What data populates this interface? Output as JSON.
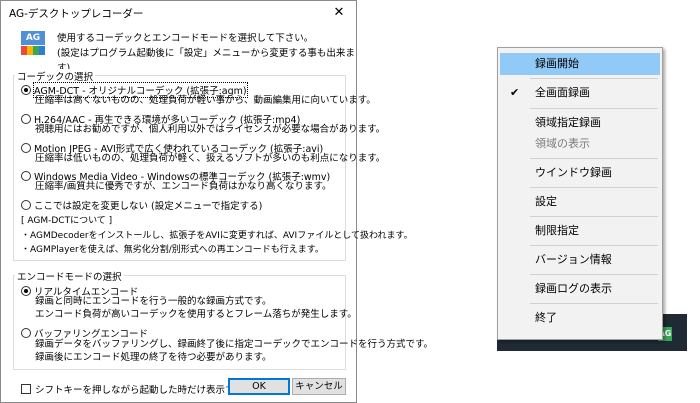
{
  "dialog": {
    "title": "AG-デスクトップレコーダー",
    "close_glyph": "✕",
    "intro_line1": "使用するコーデックとエンコードモードを選択して下さい。",
    "intro_line2": "(設定はプログラム起動後に「設定」メニューから変更する事も出来ます)",
    "icon_label": "AG",
    "icon_bar_colors": [
      "#e94b3c",
      "#f6b600",
      "#3aa757",
      "#2d7fd3"
    ],
    "codec_group": {
      "legend": "コーデックの選択",
      "options": [
        {
          "label": "AGM-DCT - オリジナルコーデック (拡張子:agm)",
          "desc": "圧縮率は高くないものの、処理負荷が軽い事から、動画編集用に向いています。",
          "checked": true
        },
        {
          "label": "H.264/AAC - 再生できる環境が多いコーデック (拡張子:mp4)",
          "desc": "視聴用にはお勧めですが、個人利用以外ではライセンスが必要な場合があります。",
          "checked": false
        },
        {
          "label": "Motion JPEG - AVI形式で広く使われているコーデック (拡張子:avi)",
          "desc": "圧縮率は低いものの、処理負荷が軽く、扱えるソフトが多いのも利点になります。",
          "checked": false
        },
        {
          "label": "Windows Media Video - Windowsの標準コーデック (拡張子:wmv)",
          "desc": "圧縮率/画質共に優秀ですが、エンコード負荷はかなり高くなります。",
          "checked": false
        },
        {
          "label": "ここでは設定を変更しない (設定メニューで指定する)",
          "desc": "",
          "checked": false
        }
      ],
      "note_title": "[ AGM-DCTについて ]",
      "note_line1": "・AGMDecoderをインストールし、拡張子をAVIに変更すれば、AVIファイルとして扱われます。",
      "note_line2": "・AGMPlayerを使えば、無劣化分割/別形式への再エンコードも行えます。"
    },
    "encode_group": {
      "legend": "エンコードモードの選択",
      "options": [
        {
          "label": "リアルタイムエンコード",
          "desc1": "録画と同時にエンコードを行う一般的な録画方式です。",
          "desc2": "エンコード負荷が高いコーデックを使用するとフレーム落ちが発生します。",
          "checked": true
        },
        {
          "label": "バッファリングエンコード",
          "desc1": "録画データをバッファリングし、録画終了後に指定コーデックでエンコードを行う方式です。",
          "desc2": "録画後にエンコード処理の終了を待つ必要があります。",
          "checked": false
        }
      ]
    },
    "shift_checkbox_label": "シフトキーを押しながら起動した時だけ表示する",
    "ok_label": "OK",
    "cancel_label": "キャンセル"
  },
  "tray": {
    "chevron": "︿",
    "icon_label": "AG"
  },
  "context_menu": {
    "check_glyph": "✔",
    "items": [
      {
        "label": "録画開始",
        "highlighted": true,
        "checked": false,
        "disabled": false
      },
      {
        "label": "全画面録画",
        "highlighted": false,
        "checked": true,
        "disabled": false
      },
      {
        "label": "領域指定録画",
        "highlighted": false,
        "checked": false,
        "disabled": false
      },
      {
        "label": "領域の表示",
        "highlighted": false,
        "checked": false,
        "disabled": true
      },
      {
        "label": "ウインドウ録画",
        "highlighted": false,
        "checked": false,
        "disabled": false
      },
      {
        "label": "設定",
        "highlighted": false,
        "checked": false,
        "disabled": false
      },
      {
        "label": "制限指定",
        "highlighted": false,
        "checked": false,
        "disabled": false
      },
      {
        "label": "バージョン情報",
        "highlighted": false,
        "checked": false,
        "disabled": false
      },
      {
        "label": "録画ログの表示",
        "highlighted": false,
        "checked": false,
        "disabled": false
      },
      {
        "label": "終了",
        "highlighted": false,
        "checked": false,
        "disabled": false
      }
    ]
  }
}
